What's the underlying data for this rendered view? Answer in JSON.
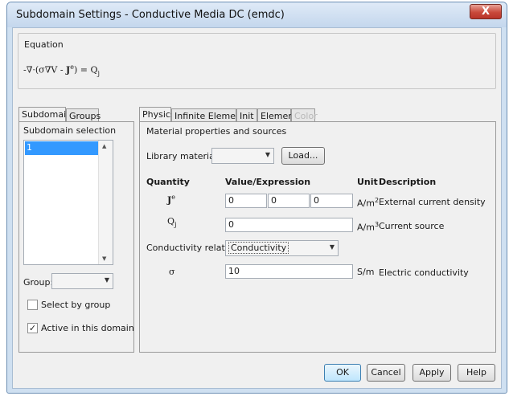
{
  "window": {
    "title": "Subdomain Settings - Conductive Media DC (emdc)",
    "close_glyph": "X"
  },
  "equation": {
    "label": "Equation",
    "formula_html": "-∇·(σ∇V - <b>J</b><sup>e</sup>) = Q<sub>j</sub>"
  },
  "left": {
    "tabs": [
      "Subdomains",
      "Groups"
    ],
    "selection_label": "Subdomain selection",
    "items": [
      "1"
    ],
    "group_label": "Group:",
    "select_by_group": "Select by group",
    "active_in_domain": "Active in this domain",
    "active_checked": true
  },
  "right": {
    "tabs": [
      "Physics",
      "Infinite Elements",
      "Init",
      "Element",
      "Color"
    ],
    "section_title": "Material properties and sources",
    "library_label": "Library material:",
    "load_button": "Load...",
    "headers": {
      "quantity": "Quantity",
      "value": "Value/Expression",
      "unit": "Unit",
      "description": "Description"
    },
    "rows": {
      "je": {
        "quantity_html": "<b>J</b><sup>e</sup>",
        "values": [
          "0",
          "0",
          "0"
        ],
        "unit_html": "A/m<sup>2</sup>",
        "description": "External current density"
      },
      "qj": {
        "quantity_html": "Q<sub>j</sub>",
        "value": "0",
        "unit_html": "A/m<sup>3</sup>",
        "description": "Current source"
      },
      "sigma": {
        "quantity": "σ",
        "value": "10",
        "unit": "S/m",
        "description": "Electric conductivity"
      }
    },
    "conductivity_label": "Conductivity relation:",
    "conductivity_value": "Conductivity"
  },
  "buttons": {
    "ok": "OK",
    "cancel": "Cancel",
    "apply": "Apply",
    "help": "Help"
  }
}
